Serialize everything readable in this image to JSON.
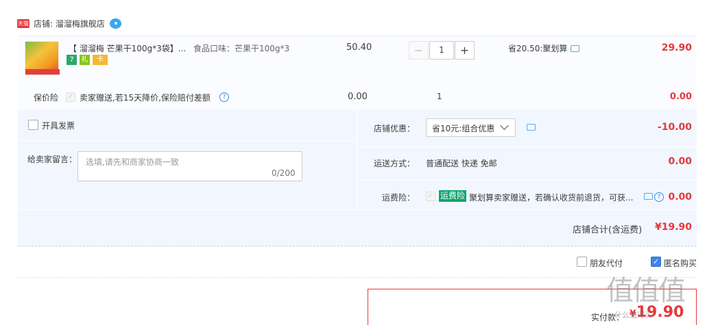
{
  "store": {
    "badge": "天猫",
    "name": "店铺: 溜溜梅旗舰店"
  },
  "item": {
    "title": "【 溜溜梅 芒果干100g*3袋】...",
    "spec": "食品口味：芒果干100g*3",
    "unit_price": "50.40",
    "qty_minus": "−",
    "quantity": "1",
    "qty_plus": "+",
    "promo": "省20.50:聚划算",
    "total": "29.90",
    "service_icons": [
      "7",
      "礼",
      "卡"
    ]
  },
  "insurance": {
    "label": "保价险",
    "description": "卖家赠送,若15天降价,保险赔付差额",
    "help": "?",
    "price": "0.00",
    "qty": "1",
    "total": "0.00"
  },
  "invoice": {
    "label": "开具发票"
  },
  "message": {
    "label": "给卖家留言：",
    "placeholder": "选填,请先和商家协商一致",
    "counter": "0/200"
  },
  "coupon": {
    "label": "店铺优惠：",
    "selected": "省10元:组合优惠",
    "amount": "-10.00"
  },
  "shipping": {
    "label": "运送方式：",
    "value": "普通配送 快递 免邮",
    "amount": "0.00"
  },
  "freight_insurance": {
    "label": "运费险：",
    "tag": "运费险",
    "text": "聚划算卖家赠送，若确认收货前退货，可获...",
    "help": "?",
    "amount": "0.00"
  },
  "store_total": {
    "label": "店铺合计(含运费)",
    "value": "¥19.90"
  },
  "options": {
    "friend_pay": "朋友代付",
    "anonymous": "匿名购买"
  },
  "payment": {
    "label": "实付款：",
    "currency": "¥",
    "value": "19.90"
  },
  "watermark": {
    "text": "值值值",
    "sub": "什么值得买"
  },
  "colors": {
    "price_red": "#e4393c",
    "panel_blue": "#f2f7ff",
    "freight_green": "#13a36e",
    "checkbox_blue": "#3b84ea"
  }
}
